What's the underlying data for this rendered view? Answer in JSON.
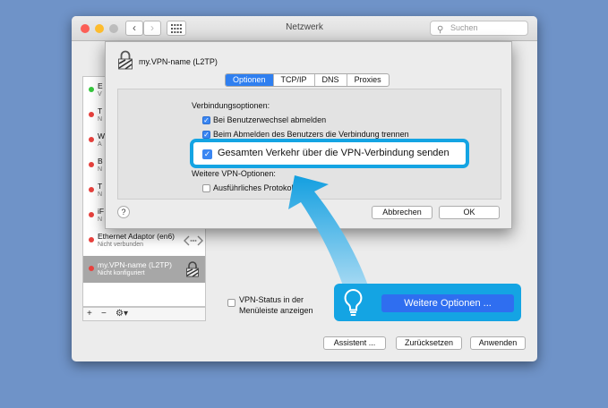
{
  "window": {
    "title": "Netzwerk",
    "search_placeholder": "Suchen"
  },
  "services": [
    {
      "name": "E",
      "status": "V",
      "status_color": "#35c83c"
    },
    {
      "name": "T",
      "status": "N",
      "status_color": "#e8413d"
    },
    {
      "name": "W",
      "status": "A",
      "status_color": "#e8413d"
    },
    {
      "name": "B",
      "status": "N",
      "status_color": "#e8413d"
    },
    {
      "name": "T",
      "status": "N",
      "status_color": "#e8413d"
    },
    {
      "name": "iF",
      "status": "N",
      "status_color": "#e8413d"
    },
    {
      "name": "Ethernet Adaptor (en6)",
      "status": "Nicht verbunden",
      "status_color": "#e8413d"
    },
    {
      "name": "my.VPN-name (L2TP)",
      "status": "Nicht konfiguriert",
      "status_color": "#e8413d"
    }
  ],
  "sidebar_bar": {
    "add": "+",
    "remove": "−",
    "gear": "⚙▾"
  },
  "dialog": {
    "title": "my.VPN-name (L2TP)",
    "tabs": [
      "Optionen",
      "TCP/IP",
      "DNS",
      "Proxies"
    ],
    "section1": "Verbindungsoptionen:",
    "opt1": "Bei Benutzerwechsel abmelden",
    "opt2": "Beim Abmelden des Benutzers die Verbindung trennen",
    "highlight": "Gesamten Verkehr über die VPN-Verbindung senden",
    "section2": "Weitere VPN-Optionen:",
    "opt4": "Ausführliches Protokoll",
    "help": "?",
    "cancel": "Abbrechen",
    "ok": "OK"
  },
  "vpn_status": {
    "line1": "VPN-Status in der",
    "line2": "Menüleiste anzeigen"
  },
  "advanced_button": "Weitere Optionen ...",
  "bottom_buttons": {
    "assistant": "Assistent ...",
    "reset": "Zurücksetzen",
    "apply": "Anwenden"
  },
  "colors": {
    "accent": "#2f6ef0",
    "highlight": "#14a4e3"
  }
}
